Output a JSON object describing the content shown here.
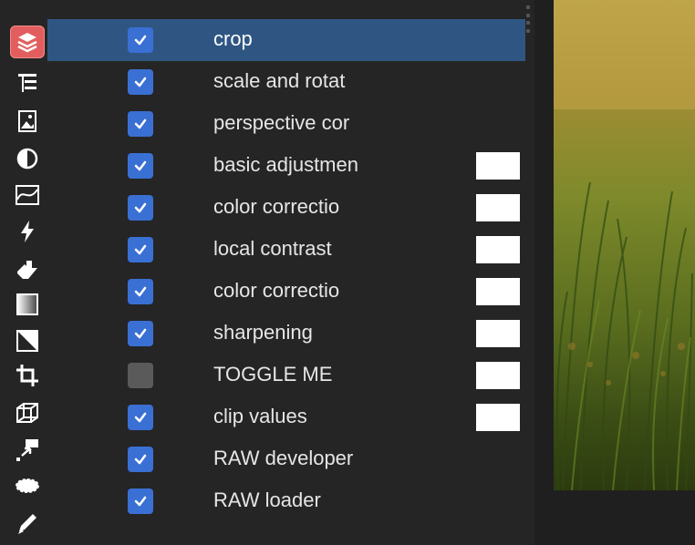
{
  "tools": [
    {
      "name": "layers-icon",
      "active": true
    },
    {
      "name": "tree-icon"
    },
    {
      "name": "image-icon"
    },
    {
      "name": "contrast-icon"
    },
    {
      "name": "curve-icon"
    },
    {
      "name": "lightning-icon"
    },
    {
      "name": "dropper-icon"
    },
    {
      "name": "gradient-icon"
    },
    {
      "name": "diagonal-icon"
    },
    {
      "name": "crop-icon"
    },
    {
      "name": "cube-icon"
    },
    {
      "name": "transform-icon"
    },
    {
      "name": "ellipse-icon"
    },
    {
      "name": "pencil-icon"
    }
  ],
  "modules": [
    {
      "label": "crop",
      "checked": true,
      "selected": true,
      "swatch": false
    },
    {
      "label": "scale and rotat",
      "checked": true,
      "swatch": false
    },
    {
      "label": "perspective cor",
      "checked": true,
      "swatch": false
    },
    {
      "label": "basic adjustmen",
      "checked": true,
      "swatch": true
    },
    {
      "label": "color correctio",
      "checked": true,
      "swatch": true
    },
    {
      "label": "local contrast",
      "checked": true,
      "swatch": true
    },
    {
      "label": "color correctio",
      "checked": true,
      "swatch": true
    },
    {
      "label": "sharpening",
      "checked": true,
      "swatch": true
    },
    {
      "label": "TOGGLE ME",
      "checked": false,
      "swatch": true
    },
    {
      "label": "clip values",
      "checked": true,
      "swatch": true
    },
    {
      "label": "RAW developer",
      "checked": true,
      "swatch": false
    },
    {
      "label": "RAW loader",
      "checked": true,
      "swatch": false
    }
  ],
  "colors": {
    "background": "#252525",
    "selected_row": "#2f5683",
    "checkbox_on": "#3a70d4",
    "checkbox_off": "#5a5a5a",
    "active_tool": "#e25e5e"
  }
}
